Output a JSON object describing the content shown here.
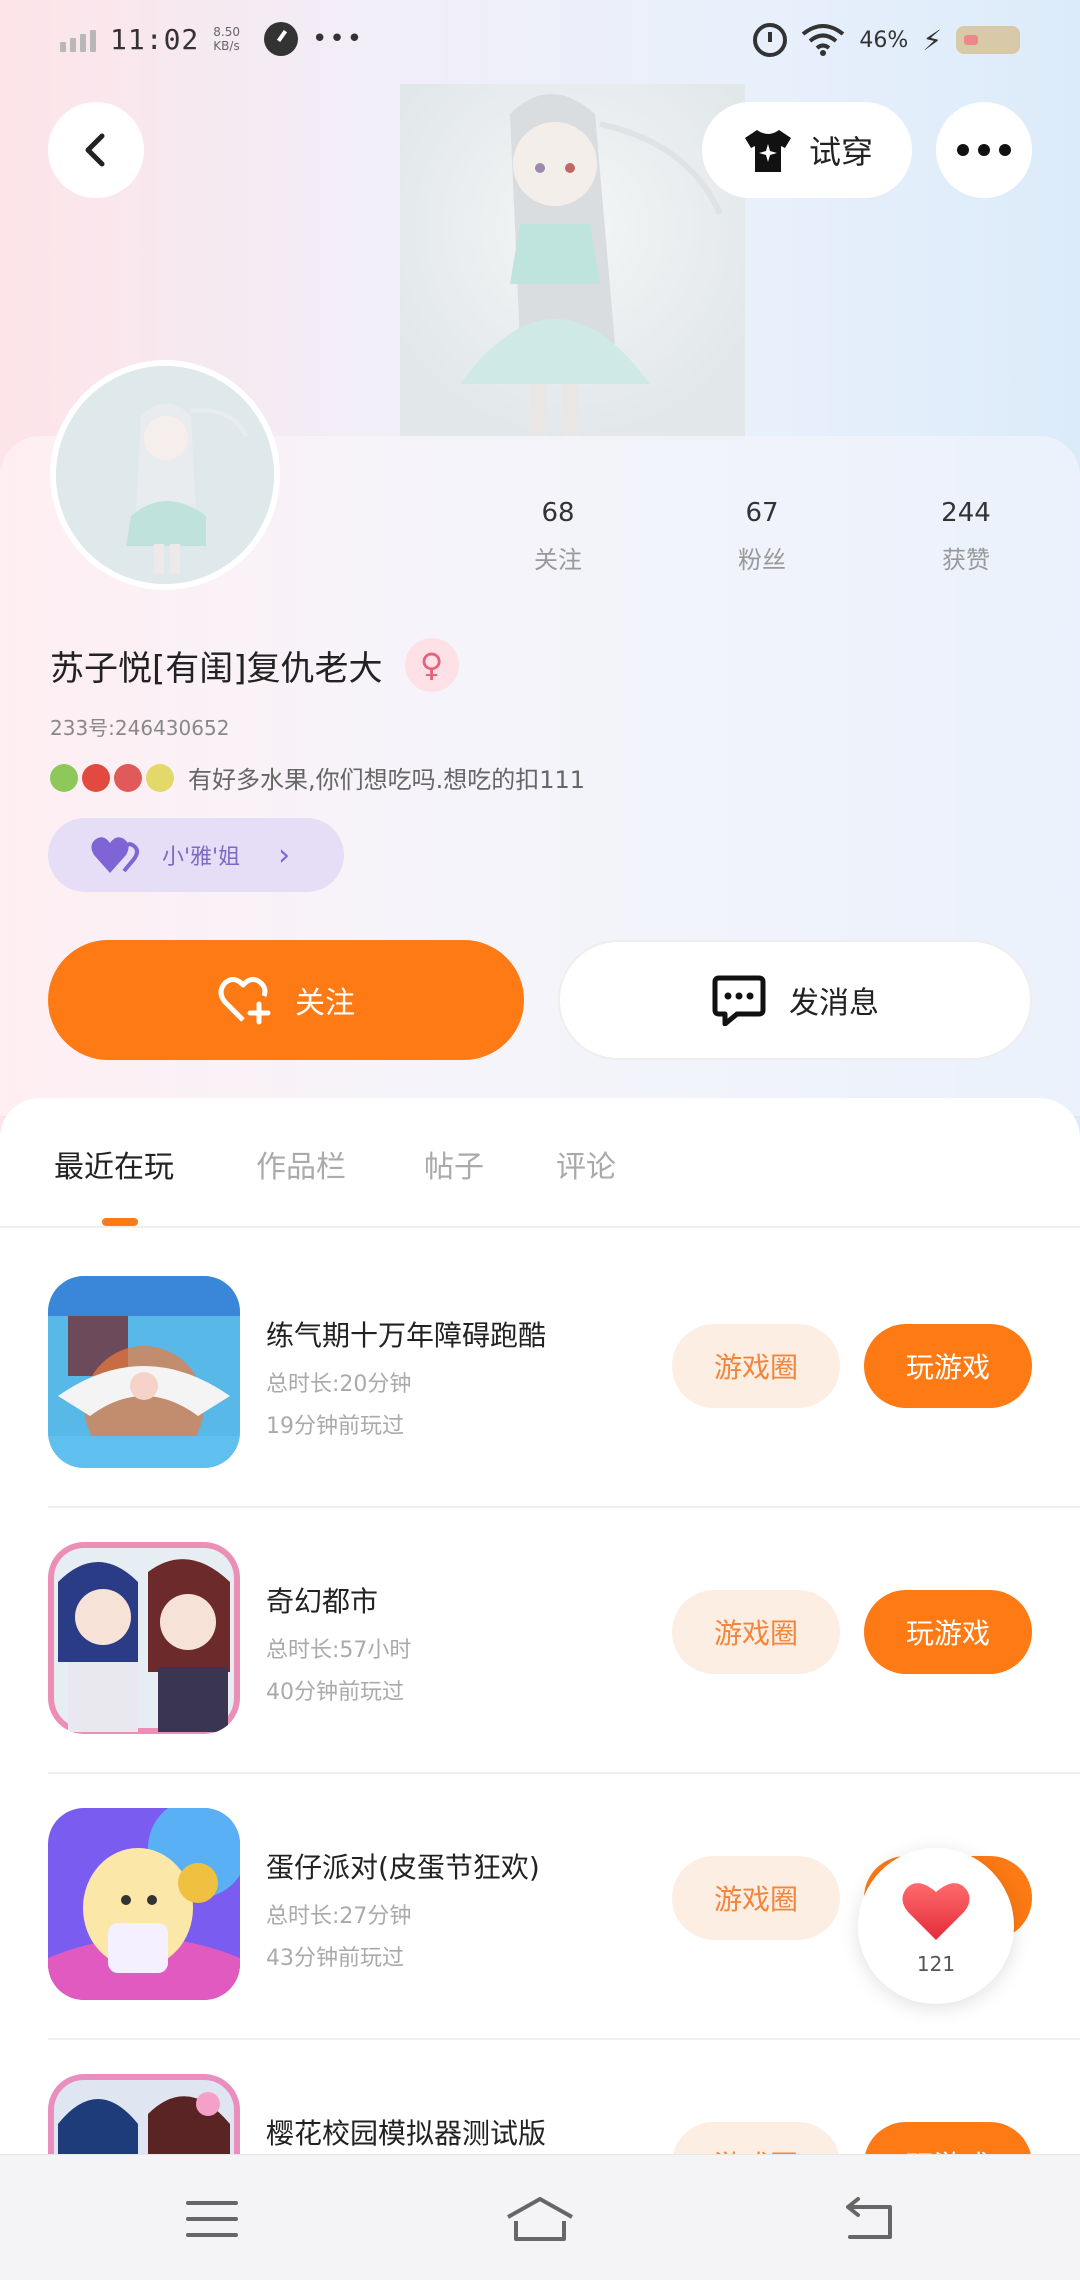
{
  "status_bar": {
    "time": "11:02",
    "net_speed_value": "8.50",
    "net_speed_unit": "KB/s",
    "battery_percent": "46%"
  },
  "hero": {
    "tryon_label": "试穿"
  },
  "profile": {
    "stats": [
      {
        "value": "68",
        "label": "关注"
      },
      {
        "value": "67",
        "label": "粉丝"
      },
      {
        "value": "244",
        "label": "获赞"
      }
    ],
    "nickname": "苏子悦[有闺]复仇老大",
    "gender_symbol": "♀",
    "uid": "233号:246430652",
    "bio": "有好多水果,你们想吃吗.想吃的扣111",
    "guard_label": "小'雅'姐",
    "follow_label": "关注",
    "message_label": "发消息"
  },
  "tabs": [
    {
      "label": "最近在玩",
      "active": true
    },
    {
      "label": "作品栏",
      "active": false
    },
    {
      "label": "帖子",
      "active": false
    },
    {
      "label": "评论",
      "active": false
    }
  ],
  "games": [
    {
      "title": "练气期十万年障碍跑酷",
      "total": "总时长:20分钟",
      "last": "19分钟前玩过",
      "circle": "游戏圈",
      "play": "玩游戏"
    },
    {
      "title": "奇幻都市",
      "total": "总时长:57小时",
      "last": "40分钟前玩过",
      "circle": "游戏圈",
      "play": "玩游戏"
    },
    {
      "title": "蛋仔派对(皮蛋节狂欢)",
      "total": "总时长:27分钟",
      "last": "43分钟前玩过",
      "circle": "游戏圈",
      "play": "玩游戏"
    },
    {
      "title": "樱花校园模拟器测试版",
      "total": "",
      "last": "",
      "circle": "游戏圈",
      "play": "玩游戏"
    }
  ],
  "like_float": {
    "count": "121"
  },
  "colors": {
    "accent": "#fd7a14",
    "accent_soft": "#fdeee3",
    "guard_bg": "#e6def6",
    "gender": "#e7607c"
  }
}
